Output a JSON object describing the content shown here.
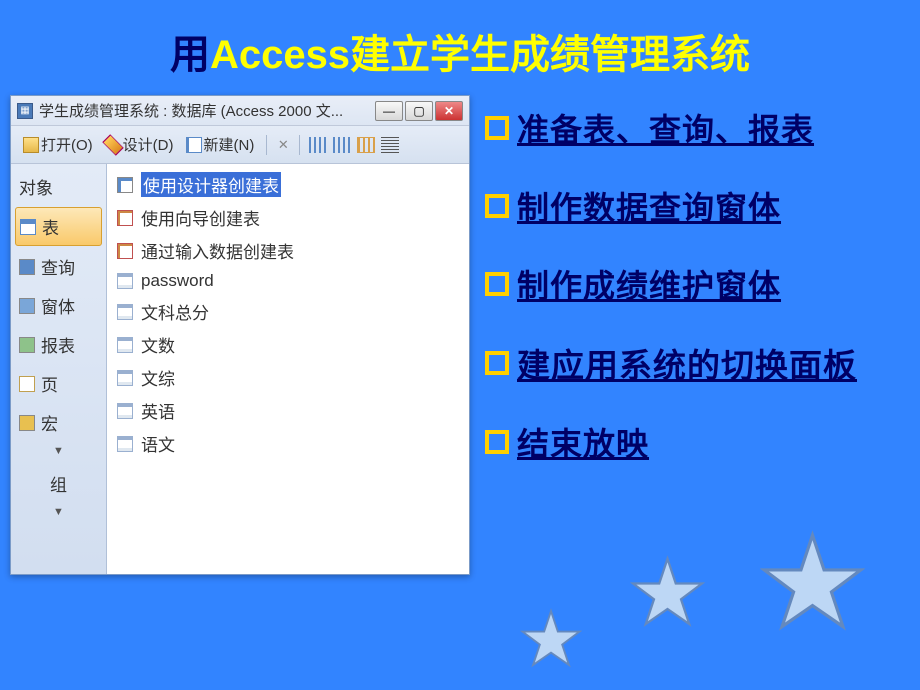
{
  "slide": {
    "title_pre": "用",
    "title_highlight": "Access",
    "title_post": "建立学生成绩管理系统"
  },
  "db_window": {
    "title": "学生成绩管理系统 : 数据库 (Access 2000 文...",
    "toolbar": {
      "open": "打开(O)",
      "design": "设计(D)",
      "new": "新建(N)"
    },
    "sidebar": {
      "header": "对象",
      "items": [
        {
          "label": "表",
          "selected": true
        },
        {
          "label": "查询",
          "selected": false
        },
        {
          "label": "窗体",
          "selected": false
        },
        {
          "label": "报表",
          "selected": false
        },
        {
          "label": "页",
          "selected": false
        },
        {
          "label": "宏",
          "selected": false
        }
      ],
      "group": "组"
    },
    "objects": [
      {
        "label": "使用设计器创建表",
        "icon": "wizard",
        "selected": true
      },
      {
        "label": "使用向导创建表",
        "icon": "wizard2",
        "selected": false
      },
      {
        "label": "通过输入数据创建表",
        "icon": "wizard2",
        "selected": false
      },
      {
        "label": "password",
        "icon": "table",
        "selected": false
      },
      {
        "label": "文科总分",
        "icon": "table",
        "selected": false
      },
      {
        "label": "文数",
        "icon": "table",
        "selected": false
      },
      {
        "label": "文综",
        "icon": "table",
        "selected": false
      },
      {
        "label": "英语",
        "icon": "table",
        "selected": false
      },
      {
        "label": "语文",
        "icon": "table",
        "selected": false
      }
    ]
  },
  "bullets": [
    {
      "text": "准备表、查询、报表"
    },
    {
      "text": "制作数据查询窗体"
    },
    {
      "text": "制作成绩维护窗体"
    },
    {
      "text": "建应用系统的切换面板"
    },
    {
      "text": "结束放映"
    }
  ]
}
